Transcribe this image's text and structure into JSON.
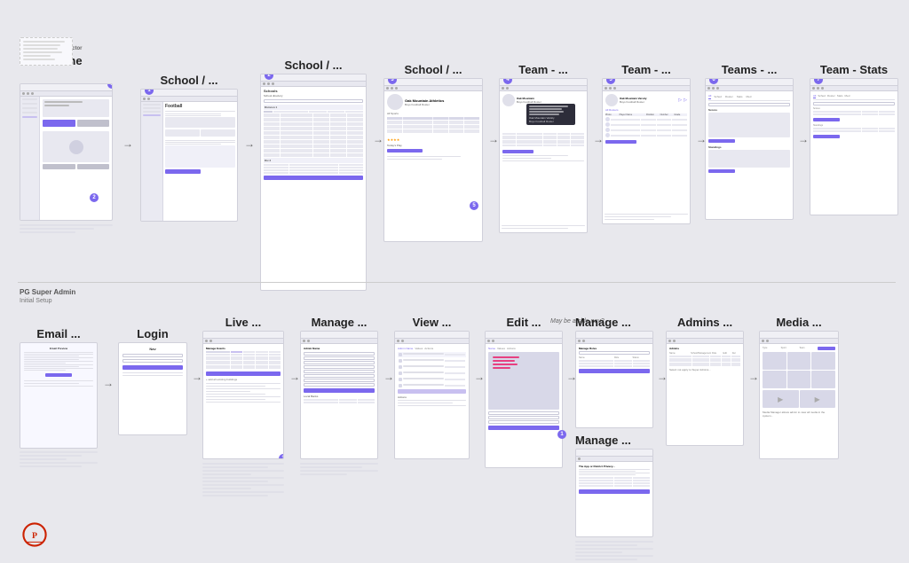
{
  "top_row": {
    "sections": [
      {
        "id": "home",
        "small_label": "Bus/Director",
        "big_label": "Home",
        "badge": null,
        "has_note": true,
        "note_lines": 6,
        "has_subnote": true,
        "type": "home"
      },
      {
        "id": "school1",
        "small_label": "",
        "big_label": "School / ...",
        "badge": "1",
        "type": "school-list"
      },
      {
        "id": "school2",
        "small_label": "",
        "big_label": "School / ...",
        "badge": "2",
        "type": "school-division"
      },
      {
        "id": "school3",
        "small_label": "",
        "big_label": "School / ...",
        "badge": "3",
        "type": "school-team"
      },
      {
        "id": "team1",
        "small_label": "",
        "big_label": "Team - ...",
        "badge": "4",
        "type": "team-roster"
      },
      {
        "id": "team2",
        "small_label": "",
        "big_label": "Team - ...",
        "badge": "5",
        "type": "team-detail"
      },
      {
        "id": "teams",
        "small_label": "",
        "big_label": "Teams - ...",
        "badge": "6",
        "type": "teams-list"
      },
      {
        "id": "teamstats",
        "small_label": "",
        "big_label": "Team - Stats",
        "badge": "7",
        "type": "team-stats"
      }
    ]
  },
  "bottom_row": {
    "admin_label": "PG Super Admin",
    "admin_sublabel": "Initial Setup",
    "sections": [
      {
        "id": "email",
        "small_label": "",
        "big_label": "Email ...",
        "type": "email"
      },
      {
        "id": "login",
        "small_label": "",
        "big_label": "Login",
        "type": "login"
      },
      {
        "id": "live",
        "small_label": "",
        "big_label": "Live ...",
        "type": "live"
      },
      {
        "id": "manage",
        "small_label": "",
        "big_label": "Manage ...",
        "type": "manage"
      },
      {
        "id": "view",
        "small_label": "",
        "big_label": "View ...",
        "type": "view"
      },
      {
        "id": "edit",
        "small_label": "",
        "big_label": "Edit ...",
        "type": "edit"
      },
      {
        "id": "maybe-side",
        "small_label": "May be a side nav?",
        "big_label": "",
        "type": "side-nav"
      },
      {
        "id": "manage2",
        "small_label": "",
        "big_label": "Manage ...",
        "type": "manage2"
      },
      {
        "id": "admins",
        "small_label": "",
        "big_label": "Admins ...",
        "type": "admins"
      },
      {
        "id": "media",
        "small_label": "",
        "big_label": "Media ...",
        "type": "media"
      }
    ]
  },
  "colors": {
    "accent": "#7b68ee",
    "background": "#e8e8ed",
    "card_bg": "#ffffff",
    "card_border": "#d0d0da",
    "line": "#e0e0e8",
    "text_dark": "#222222",
    "text_mid": "#555555",
    "text_light": "#888888"
  }
}
